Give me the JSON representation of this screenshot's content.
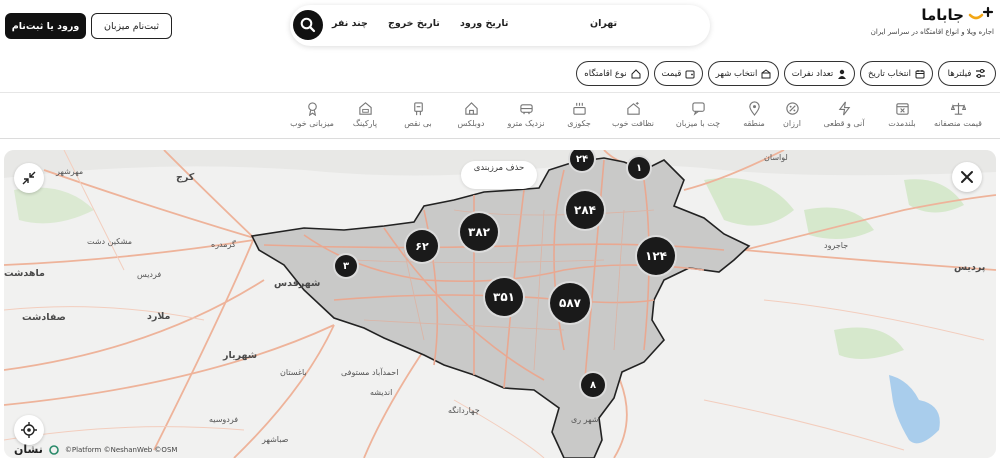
{
  "header": {
    "logo_name": "جاباما",
    "logo_tagline": "اجاره ویلا و انواع اقامتگاه در سراسر ایران",
    "search": {
      "destination": "تهران",
      "checkin": "تاریخ ورود",
      "checkout": "تاریخ خروج",
      "guests": "چند نفر"
    },
    "login_label": "ورود یا ثبت‌نام",
    "host_label": "ثبت‌نام میزبان"
  },
  "filters": [
    {
      "label": "فیلترها",
      "icon": "sliders-icon"
    },
    {
      "label": "انتخاب تاریخ",
      "icon": "calendar-icon"
    },
    {
      "label": "تعداد نفرات",
      "icon": "person-icon"
    },
    {
      "label": "انتخاب شهر",
      "icon": "city-icon"
    },
    {
      "label": "قیمت",
      "icon": "wallet-icon"
    },
    {
      "label": "نوع اقامتگاه",
      "icon": "house-icon"
    }
  ],
  "categories": [
    {
      "label": "قیمت منصفانه",
      "icon": "scale-icon"
    },
    {
      "label": "بلندمدت",
      "icon": "calendar-x-icon"
    },
    {
      "label": "آنی و قطعی",
      "icon": "lightning-icon"
    },
    {
      "label": "ارزان",
      "icon": "discount-icon"
    },
    {
      "label": "منطقه",
      "icon": "location-icon"
    },
    {
      "label": "چت با میزبان",
      "icon": "chat-icon"
    },
    {
      "label": "نظافت خوب",
      "icon": "clean-house-icon"
    },
    {
      "label": "جکوزی",
      "icon": "jacuzzi-icon"
    },
    {
      "label": "نزدیک مترو",
      "icon": "metro-icon"
    },
    {
      "label": "دوبلکس",
      "icon": "duplex-icon"
    },
    {
      "label": "بی نقص",
      "icon": "perfect-icon"
    },
    {
      "label": "پارکینگ",
      "icon": "parking-icon"
    },
    {
      "label": "میزبانی خوب",
      "icon": "good-host-icon"
    }
  ],
  "map": {
    "remove_bounds_label": "حذف مرزبندی",
    "clusters": [
      {
        "count": "۲۴"
      },
      {
        "count": "۱"
      },
      {
        "count": "۲۸۴"
      },
      {
        "count": "۳۸۲"
      },
      {
        "count": "۶۲"
      },
      {
        "count": "۱۲۴"
      },
      {
        "count": "۳"
      },
      {
        "count": "۳۵۱"
      },
      {
        "count": "۵۸۷"
      },
      {
        "count": "۸"
      }
    ],
    "places": [
      "مهرشهر",
      "کرج",
      "مشکین دشت",
      "گرمدره",
      "ماهدشت",
      "فردیس",
      "شهرقدس",
      "صفادشت",
      "ملارد",
      "شهریار",
      "باغستان",
      "احمدآباد مستوفی",
      "اندیشه",
      "چهاردانگه",
      "فردوسیه",
      "صباشهر",
      "شهر ری",
      "لواسان",
      "جاجرود",
      "پردیس"
    ],
    "attribution": "©Platform ©NeshanWeb ©OSM",
    "neshan": "نشان"
  },
  "colors": {
    "accent": "#1a1a1a",
    "city_area": "#c9c9c8",
    "water": "#a9cdec",
    "park": "#cfe4c4",
    "roads": "#eeb39a"
  }
}
